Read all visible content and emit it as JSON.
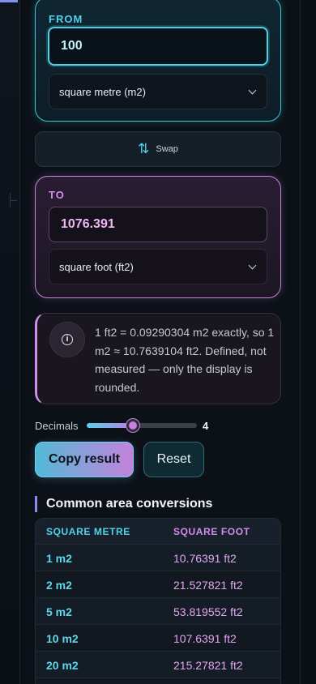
{
  "from": {
    "label": "FROM",
    "value": "100",
    "unit": "square metre (m2)"
  },
  "swap": {
    "label": "Swap",
    "icon": "swap-vertical-icon"
  },
  "to": {
    "label": "TO",
    "value": "1076.391",
    "unit": "square foot (ft2)"
  },
  "info": {
    "icon": "info-icon",
    "text": "1 ft2 = 0.09290304 m2 exactly, so 1 m2 ≈ 10.7639104 ft2. Defined, not measured — only the display is rounded."
  },
  "decimals": {
    "label": "Decimals",
    "value": "4",
    "slider_fraction": 0.42
  },
  "actions": {
    "copy_label": "Copy result",
    "reset_label": "Reset"
  },
  "table": {
    "title": "Common area conversions",
    "headers": [
      "SQUARE METRE",
      "SQUARE FOOT"
    ],
    "rows": [
      [
        "1 m2",
        "10.76391 ft2"
      ],
      [
        "2 m2",
        "21.527821 ft2"
      ],
      [
        "5 m2",
        "53.819552 ft2"
      ],
      [
        "10 m2",
        "107.6391 ft2"
      ],
      [
        "20 m2",
        "215.27821 ft2"
      ]
    ]
  },
  "colors": {
    "from_accent": "#4fd2e8",
    "to_accent": "#d58be8",
    "background": "#0c1118"
  }
}
